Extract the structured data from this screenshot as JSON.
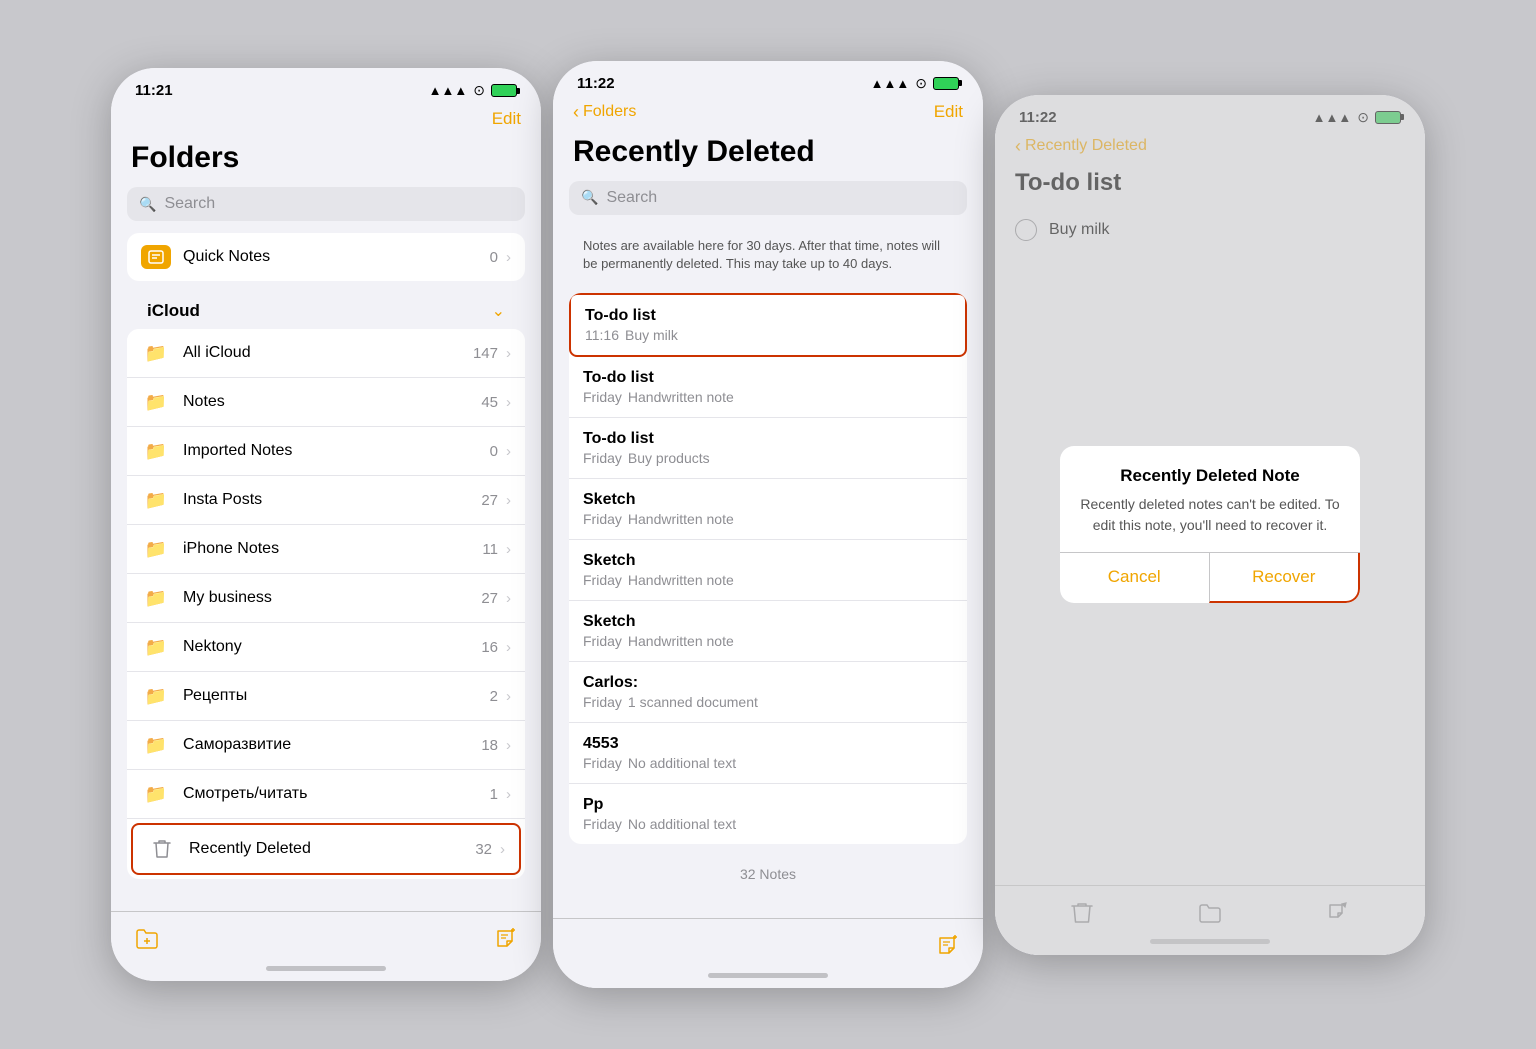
{
  "phone1": {
    "statusBar": {
      "time": "11:21",
      "hasLocation": true,
      "signal": "▲▲▲",
      "wifi": "wifi",
      "battery": "battery"
    },
    "nav": {
      "editLabel": "Edit"
    },
    "title": "Folders",
    "search": {
      "placeholder": "Search"
    },
    "quickNotes": {
      "name": "Quick Notes",
      "count": "0"
    },
    "icloud": {
      "label": "iCloud",
      "items": [
        {
          "name": "All iCloud",
          "count": "147"
        },
        {
          "name": "Notes",
          "count": "45"
        },
        {
          "name": "Imported Notes",
          "count": "0"
        },
        {
          "name": "Insta Posts",
          "count": "27"
        },
        {
          "name": "iPhone Notes",
          "count": "11"
        },
        {
          "name": "My business",
          "count": "27"
        },
        {
          "name": "Nektony",
          "count": "16"
        },
        {
          "name": "Рецепты",
          "count": "2"
        },
        {
          "name": "Саморазвитие",
          "count": "18"
        },
        {
          "name": "Смотреть/читать",
          "count": "1"
        },
        {
          "name": "Recently Deleted",
          "count": "32",
          "highlighted": true,
          "isTrash": true
        }
      ]
    },
    "toolbar": {
      "newFolderLabel": "new-folder",
      "newNoteLabel": "new-note"
    }
  },
  "phone2": {
    "statusBar": {
      "time": "11:22"
    },
    "nav": {
      "backLabel": "Folders",
      "editLabel": "Edit"
    },
    "title": "Recently Deleted",
    "search": {
      "placeholder": "Search"
    },
    "infoBanner": "Notes are available here for 30 days. After that time, notes will be permanently deleted. This may take up to 40 days.",
    "notes": [
      {
        "title": "To-do list",
        "time": "11:16",
        "preview": "Buy milk",
        "highlighted": true
      },
      {
        "title": "To-do list",
        "time": "Friday",
        "preview": "Handwritten note"
      },
      {
        "title": "To-do list",
        "time": "Friday",
        "preview": "Buy products"
      },
      {
        "title": "Sketch",
        "time": "Friday",
        "preview": "Handwritten note"
      },
      {
        "title": "Sketch",
        "time": "Friday",
        "preview": "Handwritten note"
      },
      {
        "title": "Sketch",
        "time": "Friday",
        "preview": "Handwritten note"
      },
      {
        "title": "Carlos:",
        "time": "Friday",
        "preview": "1 scanned document"
      },
      {
        "title": "4553",
        "time": "Friday",
        "preview": "No additional text"
      },
      {
        "title": "Pp",
        "time": "Friday",
        "preview": "No additional text"
      }
    ],
    "notesCount": "32 Notes",
    "toolbar": {
      "newNoteLabel": "new-note"
    }
  },
  "phone3": {
    "statusBar": {
      "time": "11:22"
    },
    "nav": {
      "backLabel": "Recently Deleted"
    },
    "title": "To-do list",
    "todoItem": "Buy milk",
    "modal": {
      "title": "Recently Deleted Note",
      "text": "Recently deleted notes can't be edited. To edit this note, you'll need to recover it.",
      "cancelLabel": "Cancel",
      "recoverLabel": "Recover"
    },
    "toolbar": {
      "deleteIcon": "trash",
      "moveIcon": "folder",
      "shareIcon": "share"
    }
  }
}
